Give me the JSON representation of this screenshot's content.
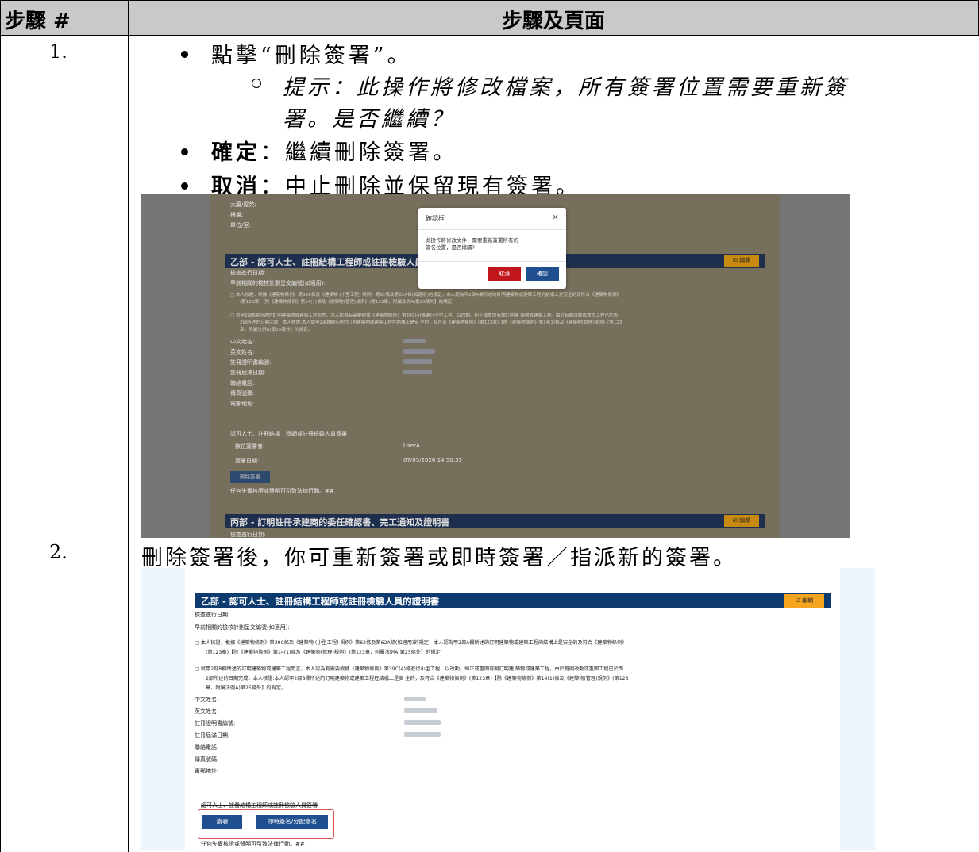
{
  "header": {
    "col1": "步驟 #",
    "col2": "步驟及頁面"
  },
  "step1": {
    "num": "1.",
    "b1": "點擊“刪除簽署”。",
    "sub": "提示：此操作將修改檔案，所有簽署位置需要重新簽",
    "sub2": "署。是否繼續？",
    "b2_bold": "確定",
    "b2_rest": "：繼續刪除簽署。",
    "b3_bold": "取消",
    "b3_rest": "：中止刪除並保留現有簽署。"
  },
  "shot1": {
    "addr": [
      "大廈/屋苑:",
      "樓層:",
      "單位/室:"
    ],
    "dialog": {
      "title": "確認框",
      "close": "×",
      "message": "此操作將修改文件，需要重新簽署所有的簽名位置，是否繼續?",
      "cancel": "取消",
      "ok": "確認"
    },
    "section_b": "乙部 - 認可人士、註冊結構工程師或註冊檢驗人員的",
    "edit": "☑ 編輯",
    "inspect_date": "檢查進行日期:",
    "early": "早前相關的檢核計劃呈交編號(如適用):",
    "decl1": "□  本人核證，根據《建築物條例》第39C條及《建築物 (小型工程) 規例》第62條及第62A條(如適用)的規定，本人認為甲2部A欄所述的訂明建築物或建築工程的結構上是安全的及符合《建築物條例》",
    "decl1b": "(第123章)【除《建築物條例》第14(1)條及《建築物(管理)規例》(第123章，附屬法例A)第25條外】的規定",
    "decl2": "□  就甲2部B欄所述的訂明建築物或建築工程而言，本人認為有需要根據《建築物條例》第39C(4)條進行小型工程，以改動、糾正或重固有關訂明建 築物或建築工程。由於有關改動或重固工程已於丙",
    "decl2b": "2部所述的日期完成，本人核證:本人認甲2部B欄所述的訂明建築物或建築工程在結構上是安 全的，及符合《建築物條例》(第123章)【除《建築物條例》第14(1)條及《建築物(管理)規例》(第123",
    "decl2c": "章，附屬法例A)第25條外】的規定。",
    "fields": [
      "中文姓名:",
      "英文姓名:",
      "註冊證明書編號:",
      "註冊屆滿日期:",
      "聯絡電話:",
      "傳真號碼:",
      "電郵地址:"
    ],
    "sig_title": "認可人士、註冊結構工程師或註冊檢驗人員簽署",
    "signer_label": "數位簽署者:",
    "signer_value": "UserA",
    "sign_date_label": "簽署日期:",
    "sign_date_value": "07/05/2026 14:50:53",
    "delete_btn": "刪除簽署",
    "warning": "任何失實核證或聲明可引致法律行動。##",
    "section_c": "丙部 - 訂明註冊承建商的委任確認書、完工通知及證明書",
    "section_c_sub": "檢查進行日期:"
  },
  "step2": {
    "num": "2.",
    "text": "刪除簽署後，你可重新簽署或即時簽署／指派新的簽署。"
  },
  "shot2": {
    "section_b": "乙部 - 認可人士、註冊結構工程師或註冊檢驗人員的證明書",
    "edit": "☑ 編輯",
    "inspect_date": "檢查進行日期:",
    "early": "早前相關的檢核計劃呈交編號(如適用):",
    "decl1": "□  本人核證，根據《建築物條例》第39C條及《建築物 (小型工程) 規例》第62條及第62A條(如適用)的規定，本人認為甲2部A欄所述的訂明建築物或建築工程的結構上是安全的及符合《建築物條例》",
    "decl1b": "(第123章)【除《建築物條例》第14(1)條及《建築物(管理)規例》(第123章，附屬法例A)第25條外】的規定",
    "decl2": "□  就甲2部B欄所述的訂明建築物或建築工程而言，本人認為有需要根據《建築物條例》第39C(4)條進行小型工程，以改動、糾正或重固有關訂明建 築物或建築工程。由於有關改動或重固工程已於丙",
    "decl2b": "2部所述的日期完成，本人核證:本人認甲2部B欄所述的訂明建築物或建築工程在結構上是安 全的，及符合《建築物條例》(第123章)【除《建築物條例》第14(1)條及《建築物(管理)規例》(第123",
    "decl2c": "章，附屬法例A)第25條外】的規定。",
    "fields": [
      "中文姓名:",
      "英文姓名:",
      "註冊證明書編號:",
      "註冊屆滿日期:",
      "聯絡電話:",
      "傳真號碼:",
      "電郵地址:"
    ],
    "sig_title": "認可人士、註冊結構工程師或註冊檢驗人員簽署",
    "sign_btn": "簽署",
    "instant_btn": "即時簽名/分配簽名",
    "warning": "任何失實核證或聲明可引致法律行動。##"
  }
}
